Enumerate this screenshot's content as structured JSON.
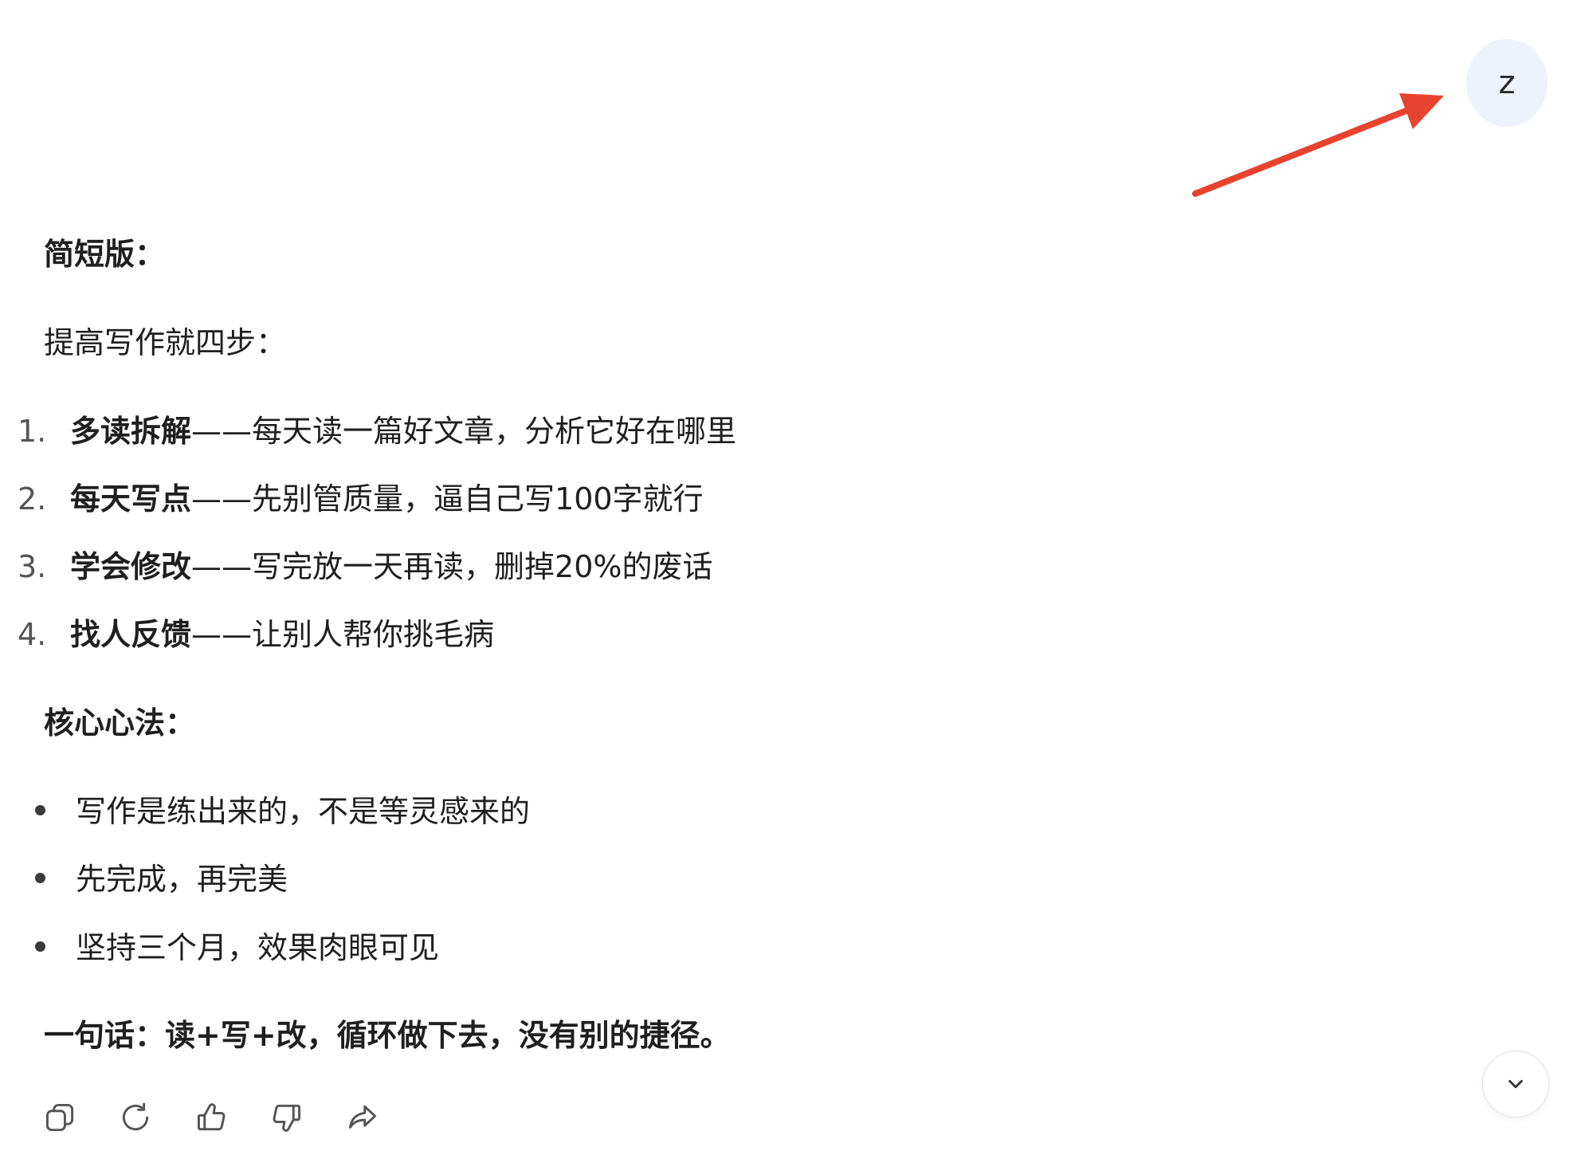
{
  "user": {
    "avatar_initial": "z"
  },
  "message": {
    "short_heading": "简短版：",
    "intro": "提高写作就四步：",
    "steps": [
      {
        "num": "1.",
        "title": "多读拆解",
        "text": "——每天读一篇好文章，分析它好在哪里"
      },
      {
        "num": "2.",
        "title": "每天写点",
        "text": "——先别管质量，逼自己写100字就行"
      },
      {
        "num": "3.",
        "title": "学会修改",
        "text": "——写完放一天再读，删掉20%的废话"
      },
      {
        "num": "4.",
        "title": "找人反馈",
        "text": "——让别人帮你挑毛病"
      }
    ],
    "core_heading": "核心心法：",
    "core_points": [
      "写作是练出来的，不是等灵感来的",
      "先完成，再完美",
      "坚持三个月，效果肉眼可见"
    ],
    "summary": "一句话：读+写+改，循环做下去，没有别的捷径。"
  },
  "actions": {
    "icons": [
      "copy-icon",
      "regenerate-icon",
      "thumbs-up-icon",
      "thumbs-down-icon",
      "share-icon"
    ]
  },
  "colors": {
    "annotation_arrow": "#e8432f",
    "avatar_bg": "#eef2fb"
  }
}
